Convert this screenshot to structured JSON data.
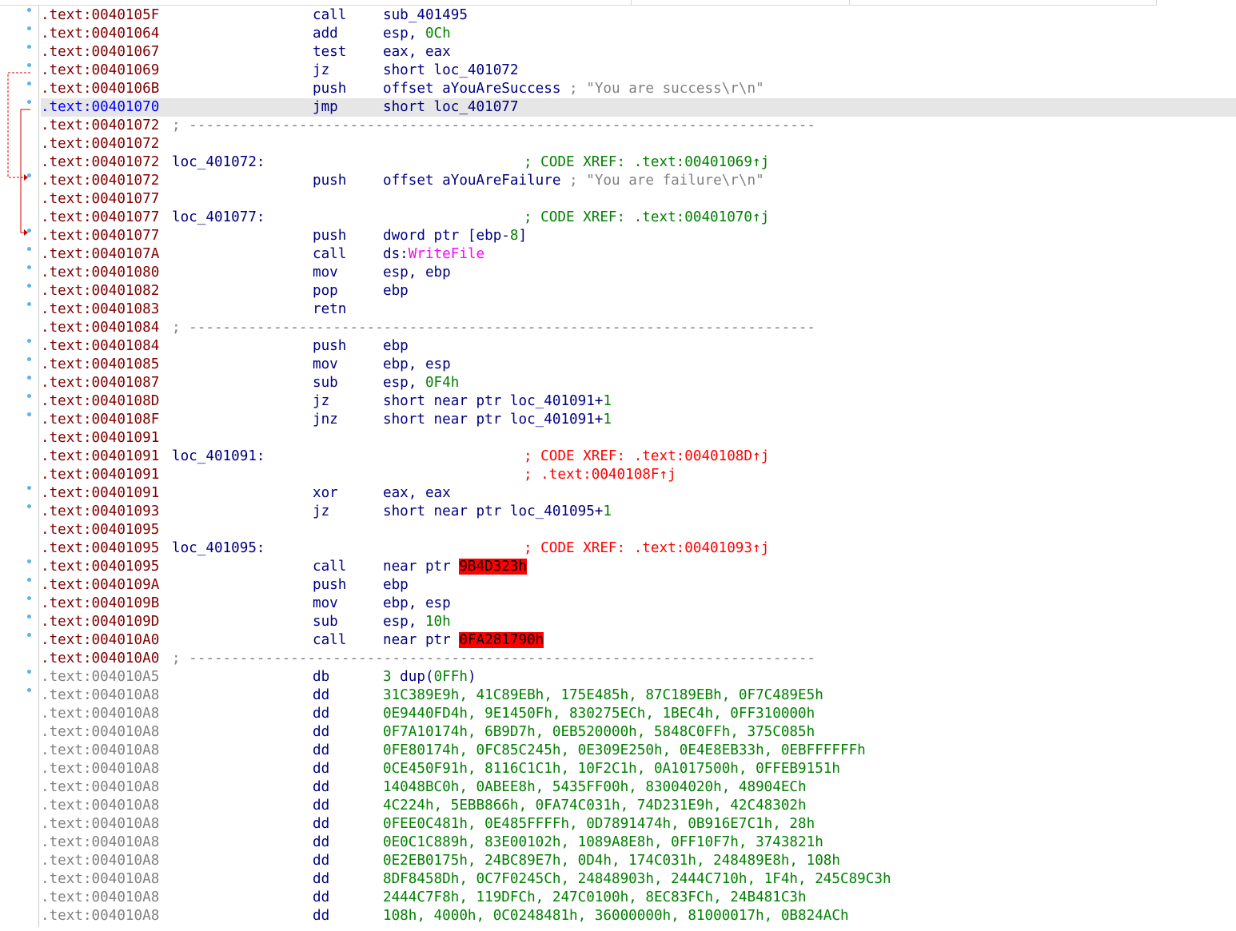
{
  "listing": [
    {
      "addr": ".text:0040105F",
      "mn": "call",
      "ops": [
        {
          "t": "sub_401495"
        }
      ],
      "dot": true
    },
    {
      "addr": ".text:00401064",
      "mn": "add",
      "ops": [
        {
          "t": "esp, "
        },
        {
          "t": "0Ch",
          "c": "num"
        }
      ],
      "dot": true
    },
    {
      "addr": ".text:00401067",
      "mn": "test",
      "ops": [
        {
          "t": "eax, eax"
        }
      ],
      "dot": true
    },
    {
      "addr": ".text:00401069",
      "mn": "jz",
      "ops": [
        {
          "t": "short loc_401072"
        }
      ],
      "dot": true
    },
    {
      "addr": ".text:0040106B",
      "mn": "push",
      "ops": [
        {
          "t": "offset aYouAreSuccess "
        },
        {
          "t": "; \"You are success\\r\\n\"",
          "c": "gr"
        }
      ],
      "dot": true
    },
    {
      "addr": ".text:00401070",
      "mn": "jmp",
      "ops": [
        {
          "t": "short loc_401077"
        }
      ],
      "dot": true,
      "selected": true
    },
    {
      "addr": ".text:00401072",
      "kind": "sep",
      "text": "; --------------------------------------------------------------------------"
    },
    {
      "addr": ".text:00401072"
    },
    {
      "addr": ".text:00401072",
      "label": "loc_401072:",
      "comment": "; CODE XREF: .text:00401069↑j"
    },
    {
      "addr": ".text:00401072",
      "mn": "push",
      "ops": [
        {
          "t": "offset aYouAreFailure "
        },
        {
          "t": "; \"You are failure\\r\\n\"",
          "c": "gr"
        }
      ],
      "dot": true
    },
    {
      "addr": ".text:00401077"
    },
    {
      "addr": ".text:00401077",
      "label": "loc_401077:",
      "comment": "; CODE XREF: .text:00401070↑j"
    },
    {
      "addr": ".text:00401077",
      "mn": "push",
      "ops": [
        {
          "t": "dword ptr [ebp-"
        },
        {
          "t": "8",
          "c": "num"
        },
        {
          "t": "]"
        }
      ],
      "dot": true
    },
    {
      "addr": ".text:0040107A",
      "mn": "call",
      "ops": [
        {
          "t": "ds:"
        },
        {
          "t": "WriteFile",
          "c": "imp"
        }
      ],
      "dot": true
    },
    {
      "addr": ".text:00401080",
      "mn": "mov",
      "ops": [
        {
          "t": "esp, ebp"
        }
      ],
      "dot": true
    },
    {
      "addr": ".text:00401082",
      "mn": "pop",
      "ops": [
        {
          "t": "ebp"
        }
      ],
      "dot": true
    },
    {
      "addr": ".text:00401083",
      "mn": "retn",
      "ops": [],
      "dot": true
    },
    {
      "addr": ".text:00401084",
      "kind": "sep",
      "text": "; --------------------------------------------------------------------------"
    },
    {
      "addr": ".text:00401084",
      "mn": "push",
      "ops": [
        {
          "t": "ebp"
        }
      ],
      "dot": true
    },
    {
      "addr": ".text:00401085",
      "mn": "mov",
      "ops": [
        {
          "t": "ebp, esp"
        }
      ],
      "dot": true
    },
    {
      "addr": ".text:00401087",
      "mn": "sub",
      "ops": [
        {
          "t": "esp, "
        },
        {
          "t": "0F4h",
          "c": "num"
        }
      ],
      "dot": true
    },
    {
      "addr": ".text:0040108D",
      "mn": "jz",
      "ops": [
        {
          "t": "short near ptr loc_401091+"
        },
        {
          "t": "1",
          "c": "num"
        }
      ],
      "dot": true
    },
    {
      "addr": ".text:0040108F",
      "mn": "jnz",
      "ops": [
        {
          "t": "short near ptr loc_401091+"
        },
        {
          "t": "1",
          "c": "num"
        }
      ],
      "dot": true
    },
    {
      "addr": ".text:00401091"
    },
    {
      "addr": ".text:00401091",
      "label": "loc_401091:",
      "comment": "; CODE XREF: .text:0040108D↑j",
      "cred": true
    },
    {
      "addr": ".text:00401091",
      "comment": "; .text:0040108F↑j",
      "cred": true
    },
    {
      "addr": ".text:00401091",
      "mn": "xor",
      "ops": [
        {
          "t": "eax, eax"
        }
      ],
      "dot": true
    },
    {
      "addr": ".text:00401093",
      "mn": "jz",
      "ops": [
        {
          "t": "short near ptr loc_401095+"
        },
        {
          "t": "1",
          "c": "num"
        }
      ],
      "dot": true
    },
    {
      "addr": ".text:00401095"
    },
    {
      "addr": ".text:00401095",
      "label": "loc_401095:",
      "comment": "; CODE XREF: .text:00401093↑j",
      "cred": true
    },
    {
      "addr": ".text:00401095",
      "mn": "call",
      "ops": [
        {
          "t": "near ptr "
        },
        {
          "t": "9B4D323h",
          "c": "bad"
        }
      ],
      "dot": true
    },
    {
      "addr": ".text:0040109A",
      "mn": "push",
      "ops": [
        {
          "t": "ebp"
        }
      ],
      "dot": true
    },
    {
      "addr": ".text:0040109B",
      "mn": "mov",
      "ops": [
        {
          "t": "ebp, esp"
        }
      ],
      "dot": true
    },
    {
      "addr": ".text:0040109D",
      "mn": "sub",
      "ops": [
        {
          "t": "esp, "
        },
        {
          "t": "10h",
          "c": "num"
        }
      ],
      "dot": true
    },
    {
      "addr": ".text:004010A0",
      "mn": "call",
      "ops": [
        {
          "t": "near ptr "
        },
        {
          "t": "0FA281790h",
          "c": "bad"
        }
      ],
      "dot": true
    },
    {
      "addr": ".text:004010A0",
      "kind": "sep",
      "text": "; --------------------------------------------------------------------------"
    },
    {
      "addr": ".text:004010A5",
      "gray": true,
      "mn": "db",
      "ops": [
        {
          "t": "3",
          "c": "num"
        },
        {
          "t": " dup("
        },
        {
          "t": "0FFh",
          "c": "num"
        },
        {
          "t": ")"
        }
      ],
      "dot": true
    },
    {
      "addr": ".text:004010A8",
      "gray": true,
      "mn": "dd",
      "ops": [
        {
          "t": "31C389E9h, 41C89EBh, 175E485h, 87C189EBh, 0F7C489E5h",
          "c": "num"
        }
      ],
      "dot": true
    },
    {
      "addr": ".text:004010A8",
      "gray": true,
      "mn": "dd",
      "ops": [
        {
          "t": "0E9440FD4h, 9E1450Fh, 830275ECh, 1BEC4h, 0FF310000h",
          "c": "num"
        }
      ]
    },
    {
      "addr": ".text:004010A8",
      "gray": true,
      "mn": "dd",
      "ops": [
        {
          "t": "0F7A10174h, 6B9D7h, 0EB520000h, 5848C0FFh, 375C085h",
          "c": "num"
        }
      ]
    },
    {
      "addr": ".text:004010A8",
      "gray": true,
      "mn": "dd",
      "ops": [
        {
          "t": "0FE80174h, 0FC85C245h, 0E309E250h, 0E4E8EB33h, 0EBFFFFFFh",
          "c": "num"
        }
      ]
    },
    {
      "addr": ".text:004010A8",
      "gray": true,
      "mn": "dd",
      "ops": [
        {
          "t": "0CE450F91h, 8116C1C1h, 10F2C1h, 0A1017500h, 0FFEB9151h",
          "c": "num"
        }
      ]
    },
    {
      "addr": ".text:004010A8",
      "gray": true,
      "mn": "dd",
      "ops": [
        {
          "t": "14048BC0h, 0ABEE8h, 5435FF00h, 83004020h, 48904ECh",
          "c": "num"
        }
      ]
    },
    {
      "addr": ".text:004010A8",
      "gray": true,
      "mn": "dd",
      "ops": [
        {
          "t": "4C224h, 5EBB866h, 0FA74C031h, 74D231E9h, 42C48302h",
          "c": "num"
        }
      ]
    },
    {
      "addr": ".text:004010A8",
      "gray": true,
      "mn": "dd",
      "ops": [
        {
          "t": "0FEE0C481h, 0E485FFFFh, 0D7891474h, 0B916E7C1h, 28h",
          "c": "num"
        }
      ]
    },
    {
      "addr": ".text:004010A8",
      "gray": true,
      "mn": "dd",
      "ops": [
        {
          "t": "0E0C1C889h, 83E00102h, 1089A8E8h, 0FF10F7h, 3743821h",
          "c": "num"
        }
      ]
    },
    {
      "addr": ".text:004010A8",
      "gray": true,
      "mn": "dd",
      "ops": [
        {
          "t": "0E2EB0175h, 24BC89E7h, 0D4h, 174C031h, 248489E8h, 108h",
          "c": "num"
        }
      ]
    },
    {
      "addr": ".text:004010A8",
      "gray": true,
      "mn": "dd",
      "ops": [
        {
          "t": "8DF8458Dh, 0C7F0245Ch, 24848903h, 2444C710h, 1F4h, 245C89C3h",
          "c": "num"
        }
      ]
    },
    {
      "addr": ".text:004010A8",
      "gray": true,
      "mn": "dd",
      "ops": [
        {
          "t": "2444C7F8h, 119DFCh, 247C0100h, 8EC83FCh, 24B481C3h",
          "c": "num"
        }
      ]
    },
    {
      "addr": ".text:004010A8",
      "gray": true,
      "mn": "dd",
      "ops": [
        {
          "t": "108h, 4000h, 0C0248481h, 36000000h, 81000017h, 0B824ACh",
          "c": "num"
        }
      ]
    }
  ],
  "colors": {
    "address": "#800000",
    "address_selected": "#0000ff",
    "address_data": "#808080",
    "code": "#000080",
    "number": "#008000",
    "xref_comment": "#008000",
    "xref_comment_bad": "#ff0000",
    "import": "#ff00ff",
    "bad_operand_bg": "#ff0000",
    "selected_line_bg": "#e6e6e6",
    "arrow": "#cc0000",
    "gutter_dot": "#5ab4e6"
  }
}
